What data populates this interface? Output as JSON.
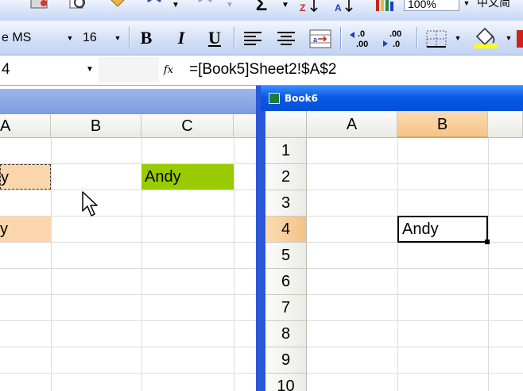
{
  "toolbar1": {
    "zoom_value": "100%",
    "language_label": "中文简"
  },
  "toolbar2": {
    "font_name": "e MS",
    "font_size": "16",
    "bold": "B",
    "italic": "I",
    "underline": "U"
  },
  "formula_bar": {
    "name_box": "4",
    "fx": "fx",
    "formula": "=[Book5]Sheet2!$A$2"
  },
  "left_window": {
    "columns": [
      "A",
      "B",
      "C"
    ],
    "cells": {
      "a_row2": "y",
      "c_row2": "Andy",
      "a_row4": "y"
    }
  },
  "right_window": {
    "title": "Book6",
    "columns": [
      "A",
      "B"
    ],
    "active_column": "B",
    "rows": [
      "1",
      "2",
      "3",
      "4",
      "5",
      "6",
      "7",
      "8",
      "9",
      "10"
    ],
    "active_row": "4",
    "cells": {
      "b4": "Andy"
    }
  },
  "colors": {
    "selection_orange": "#fbd6ad",
    "green_fill": "#99cc00",
    "titlebar_blue": "#0a5ae6"
  }
}
